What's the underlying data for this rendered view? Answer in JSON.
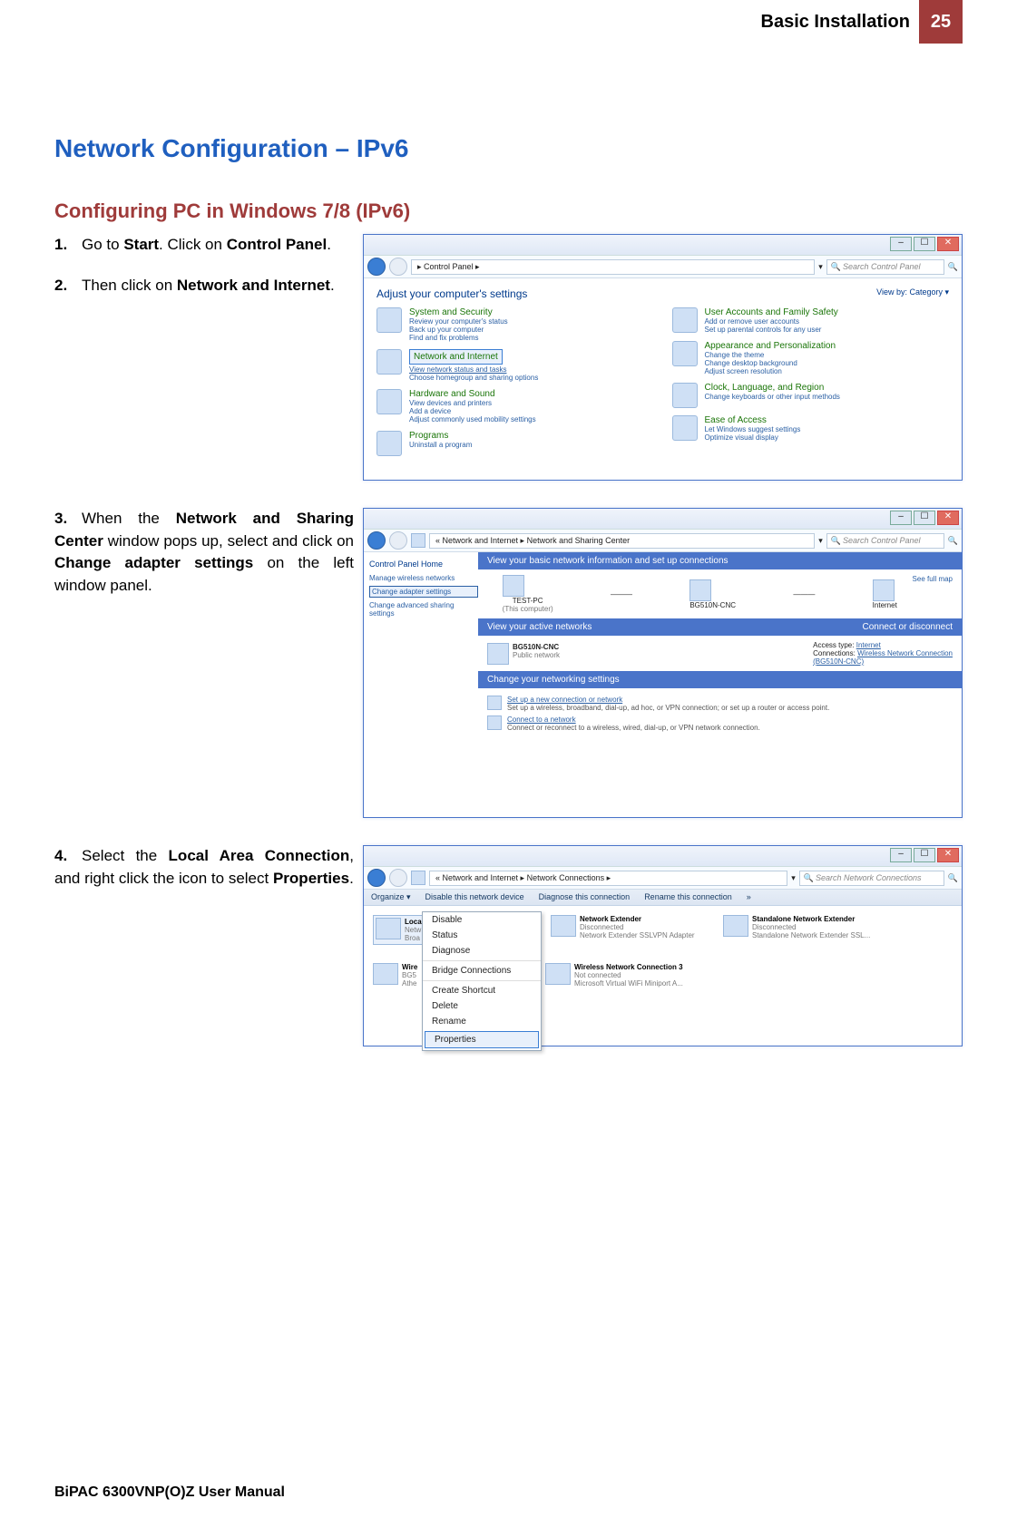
{
  "header": {
    "title": "Basic Installation",
    "page_number": "25"
  },
  "h1": "Network Configuration – IPv6",
  "h2": "Configuring PC in Windows 7/8 (IPv6)",
  "steps": {
    "s1": {
      "num": "1.",
      "text_pre": "Go to ",
      "b1": "Start",
      "text_mid": ". Click on ",
      "b2": "Control Panel",
      "text_post": "."
    },
    "s2": {
      "num": "2.",
      "text_pre": "Then click on ",
      "b1": "Network and Internet",
      "text_post": "."
    },
    "s3": {
      "num": "3.",
      "a": "When the ",
      "b1": "Network and Sharing Center",
      "b": " window pops up, select and click on ",
      "b2": "Change adapter settings",
      "c": " on the left window panel."
    },
    "s4": {
      "num": "4.",
      "a": "Select the ",
      "b1": "Local Area Connection",
      "b": ", and right click the icon to select ",
      "b2": "Properties",
      "c": "."
    }
  },
  "footer": "BiPAC 6300VNP(O)Z User Manual",
  "shot1": {
    "breadcrumb": "▸ Control Panel ▸",
    "search": "Search Control Panel",
    "heading": "Adjust your computer's settings",
    "viewby": "View by:   Category ▾",
    "left_items": [
      {
        "title": "System and Security",
        "subs": [
          "Review your computer's status",
          "Back up your computer",
          "Find and fix problems"
        ]
      },
      {
        "title": "Network and Internet",
        "subs": [
          "View network status and tasks",
          "Choose homegroup and sharing options"
        ],
        "highlighted": true
      },
      {
        "title": "Hardware and Sound",
        "subs": [
          "View devices and printers",
          "Add a device",
          "Adjust commonly used mobility settings"
        ]
      },
      {
        "title": "Programs",
        "subs": [
          "Uninstall a program"
        ]
      }
    ],
    "right_items": [
      {
        "title": "User Accounts and Family Safety",
        "subs": [
          "Add or remove user accounts",
          "Set up parental controls for any user"
        ]
      },
      {
        "title": "Appearance and Personalization",
        "subs": [
          "Change the theme",
          "Change desktop background",
          "Adjust screen resolution"
        ]
      },
      {
        "title": "Clock, Language, and Region",
        "subs": [
          "Change keyboards or other input methods"
        ]
      },
      {
        "title": "Ease of Access",
        "subs": [
          "Let Windows suggest settings",
          "Optimize visual display"
        ]
      }
    ]
  },
  "shot2": {
    "breadcrumb": "« Network and Internet ▸ Network and Sharing Center",
    "search": "Search Control Panel",
    "left_title": "Control Panel Home",
    "left_links": [
      "Manage wireless networks",
      "Change adapter settings",
      "Change advanced sharing settings"
    ],
    "banner": "View your basic network information and set up connections",
    "map_full": "See full map",
    "nodes": {
      "pc": "TEST-PC",
      "pc_sub": "(This computer)",
      "router": "BG510N-CNC",
      "net": "Internet"
    },
    "active_hdr": "View your active networks",
    "active_right": "Connect or disconnect",
    "active_net": "BG510N-CNC",
    "active_sub": "Public network",
    "access": "Access type:",
    "access_v": "Internet",
    "conn": "Connections:",
    "conn_v": "Wireless Network Connection",
    "conn_v2": "(BG510N-CNC)",
    "change_hdr": "Change your networking settings",
    "setup": [
      {
        "t": "Set up a new connection or network",
        "d": "Set up a wireless, broadband, dial-up, ad hoc, or VPN connection; or set up a router or access point."
      },
      {
        "t": "Connect to a network",
        "d": "Connect or reconnect to a wireless, wired, dial-up, or VPN network connection."
      }
    ]
  },
  "shot3": {
    "breadcrumb": "« Network and Internet ▸ Network Connections ▸",
    "search": "Search Network Connections",
    "toolbar": [
      "Organize ▾",
      "Disable this network device",
      "Diagnose this connection",
      "Rename this connection",
      "»"
    ],
    "items": [
      {
        "name": "Local Area Connection",
        "sub1": "Netw",
        "sub2": "Broa"
      },
      {
        "name": "Network Extender",
        "sub1": "Disconnected",
        "sub2": "Network Extender SSLVPN Adapter"
      },
      {
        "name": "Standalone Network Extender",
        "sub1": "Disconnected",
        "sub2": "Standalone Network Extender SSL..."
      },
      {
        "name": "Wire",
        "sub1": "BG5",
        "sub2": "Athe"
      },
      {
        "name": "Wireless Network Connection 3",
        "sub1": "Not connected",
        "sub2": "Microsoft Virtual WiFi Miniport A..."
      }
    ],
    "menu": [
      "Disable",
      "Status",
      "Diagnose",
      "Bridge Connections",
      "Create Shortcut",
      "Delete",
      "Rename",
      "Properties"
    ]
  }
}
